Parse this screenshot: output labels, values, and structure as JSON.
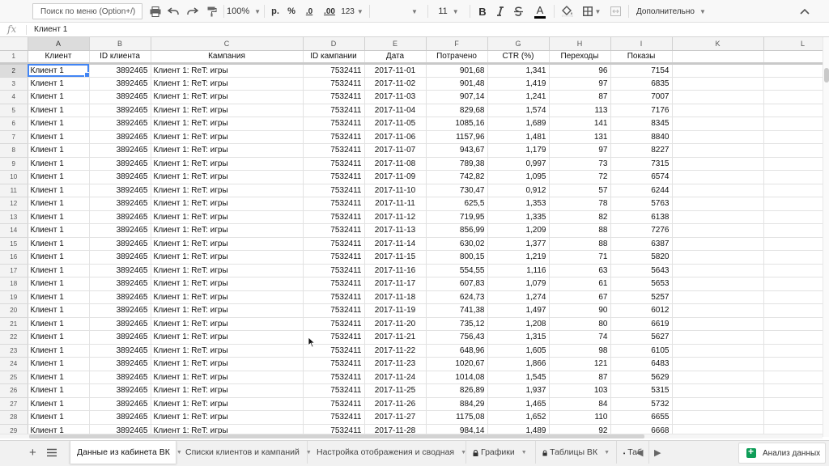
{
  "toolbar": {
    "menu_search_placeholder": "Поиск по меню (Option+/)",
    "zoom": "100%",
    "currency": "р.",
    "percent": "%",
    "decrease_decimals": ".0",
    "increase_decimals": ".00",
    "format_more": "123",
    "font_size": "11",
    "bold": "B",
    "text_color_letter": "A",
    "more": "Дополнительно"
  },
  "formula_bar": {
    "fx": "fx",
    "value": "Клиент 1"
  },
  "grid": {
    "columns": [
      "A",
      "B",
      "C",
      "D",
      "E",
      "F",
      "G",
      "H",
      "I",
      "K",
      "L"
    ],
    "header_row": [
      "Клиент",
      "ID клиента",
      "Кампания",
      "ID кампании",
      "Дата",
      "Потрачено",
      "CTR (%)",
      "Переходы",
      "Показы",
      "",
      ""
    ],
    "rows": [
      [
        "Клиент 1",
        "3892465",
        "Клиент 1: ReT: игры",
        "7532411",
        "2017-11-01",
        "901,68",
        "1,341",
        "96",
        "7154"
      ],
      [
        "Клиент 1",
        "3892465",
        "Клиент 1: ReT: игры",
        "7532411",
        "2017-11-02",
        "901,48",
        "1,419",
        "97",
        "6835"
      ],
      [
        "Клиент 1",
        "3892465",
        "Клиент 1: ReT: игры",
        "7532411",
        "2017-11-03",
        "907,14",
        "1,241",
        "87",
        "7007"
      ],
      [
        "Клиент 1",
        "3892465",
        "Клиент 1: ReT: игры",
        "7532411",
        "2017-11-04",
        "829,68",
        "1,574",
        "113",
        "7176"
      ],
      [
        "Клиент 1",
        "3892465",
        "Клиент 1: ReT: игры",
        "7532411",
        "2017-11-05",
        "1085,16",
        "1,689",
        "141",
        "8345"
      ],
      [
        "Клиент 1",
        "3892465",
        "Клиент 1: ReT: игры",
        "7532411",
        "2017-11-06",
        "1157,96",
        "1,481",
        "131",
        "8840"
      ],
      [
        "Клиент 1",
        "3892465",
        "Клиент 1: ReT: игры",
        "7532411",
        "2017-11-07",
        "943,67",
        "1,179",
        "97",
        "8227"
      ],
      [
        "Клиент 1",
        "3892465",
        "Клиент 1: ReT: игры",
        "7532411",
        "2017-11-08",
        "789,38",
        "0,997",
        "73",
        "7315"
      ],
      [
        "Клиент 1",
        "3892465",
        "Клиент 1: ReT: игры",
        "7532411",
        "2017-11-09",
        "742,82",
        "1,095",
        "72",
        "6574"
      ],
      [
        "Клиент 1",
        "3892465",
        "Клиент 1: ReT: игры",
        "7532411",
        "2017-11-10",
        "730,47",
        "0,912",
        "57",
        "6244"
      ],
      [
        "Клиент 1",
        "3892465",
        "Клиент 1: ReT: игры",
        "7532411",
        "2017-11-11",
        "625,5",
        "1,353",
        "78",
        "5763"
      ],
      [
        "Клиент 1",
        "3892465",
        "Клиент 1: ReT: игры",
        "7532411",
        "2017-11-12",
        "719,95",
        "1,335",
        "82",
        "6138"
      ],
      [
        "Клиент 1",
        "3892465",
        "Клиент 1: ReT: игры",
        "7532411",
        "2017-11-13",
        "856,99",
        "1,209",
        "88",
        "7276"
      ],
      [
        "Клиент 1",
        "3892465",
        "Клиент 1: ReT: игры",
        "7532411",
        "2017-11-14",
        "630,02",
        "1,377",
        "88",
        "6387"
      ],
      [
        "Клиент 1",
        "3892465",
        "Клиент 1: ReT: игры",
        "7532411",
        "2017-11-15",
        "800,15",
        "1,219",
        "71",
        "5820"
      ],
      [
        "Клиент 1",
        "3892465",
        "Клиент 1: ReT: игры",
        "7532411",
        "2017-11-16",
        "554,55",
        "1,116",
        "63",
        "5643"
      ],
      [
        "Клиент 1",
        "3892465",
        "Клиент 1: ReT: игры",
        "7532411",
        "2017-11-17",
        "607,83",
        "1,079",
        "61",
        "5653"
      ],
      [
        "Клиент 1",
        "3892465",
        "Клиент 1: ReT: игры",
        "7532411",
        "2017-11-18",
        "624,73",
        "1,274",
        "67",
        "5257"
      ],
      [
        "Клиент 1",
        "3892465",
        "Клиент 1: ReT: игры",
        "7532411",
        "2017-11-19",
        "741,38",
        "1,497",
        "90",
        "6012"
      ],
      [
        "Клиент 1",
        "3892465",
        "Клиент 1: ReT: игры",
        "7532411",
        "2017-11-20",
        "735,12",
        "1,208",
        "80",
        "6619"
      ],
      [
        "Клиент 1",
        "3892465",
        "Клиент 1: ReT: игры",
        "7532411",
        "2017-11-21",
        "756,43",
        "1,315",
        "74",
        "5627"
      ],
      [
        "Клиент 1",
        "3892465",
        "Клиент 1: ReT: игры",
        "7532411",
        "2017-11-22",
        "648,96",
        "1,605",
        "98",
        "6105"
      ],
      [
        "Клиент 1",
        "3892465",
        "Клиент 1: ReT: игры",
        "7532411",
        "2017-11-23",
        "1020,67",
        "1,866",
        "121",
        "6483"
      ],
      [
        "Клиент 1",
        "3892465",
        "Клиент 1: ReT: игры",
        "7532411",
        "2017-11-24",
        "1014,08",
        "1,545",
        "87",
        "5629"
      ],
      [
        "Клиент 1",
        "3892465",
        "Клиент 1: ReT: игры",
        "7532411",
        "2017-11-25",
        "826,89",
        "1,937",
        "103",
        "5315"
      ],
      [
        "Клиент 1",
        "3892465",
        "Клиент 1: ReT: игры",
        "7532411",
        "2017-11-26",
        "884,29",
        "1,465",
        "84",
        "5732"
      ],
      [
        "Клиент 1",
        "3892465",
        "Клиент 1: ReT: игры",
        "7532411",
        "2017-11-27",
        "1175,08",
        "1,652",
        "110",
        "6655"
      ],
      [
        "Клиент 1",
        "3892465",
        "Клиент 1: ReT: игры",
        "7532411",
        "2017-11-28",
        "984,14",
        "1,489",
        "92",
        "6668"
      ]
    ],
    "selected_cell": "A2"
  },
  "sheet_tabs": {
    "tabs": [
      {
        "label": "Данные из кабинета ВК",
        "locked": false,
        "active": true
      },
      {
        "label": "Списки клиентов и кампаний",
        "locked": true,
        "active": false
      },
      {
        "label": "Настройка отображения и сводная",
        "locked": true,
        "active": false
      },
      {
        "label": "Графики",
        "locked": true,
        "active": false
      },
      {
        "label": "Таблицы ВК",
        "locked": true,
        "active": false
      },
      {
        "label": "Таб",
        "locked": true,
        "active": false
      }
    ],
    "explore_label": "Анализ данных"
  },
  "colors": {
    "selection": "#4285f4",
    "explore_green": "#0f9d58"
  }
}
